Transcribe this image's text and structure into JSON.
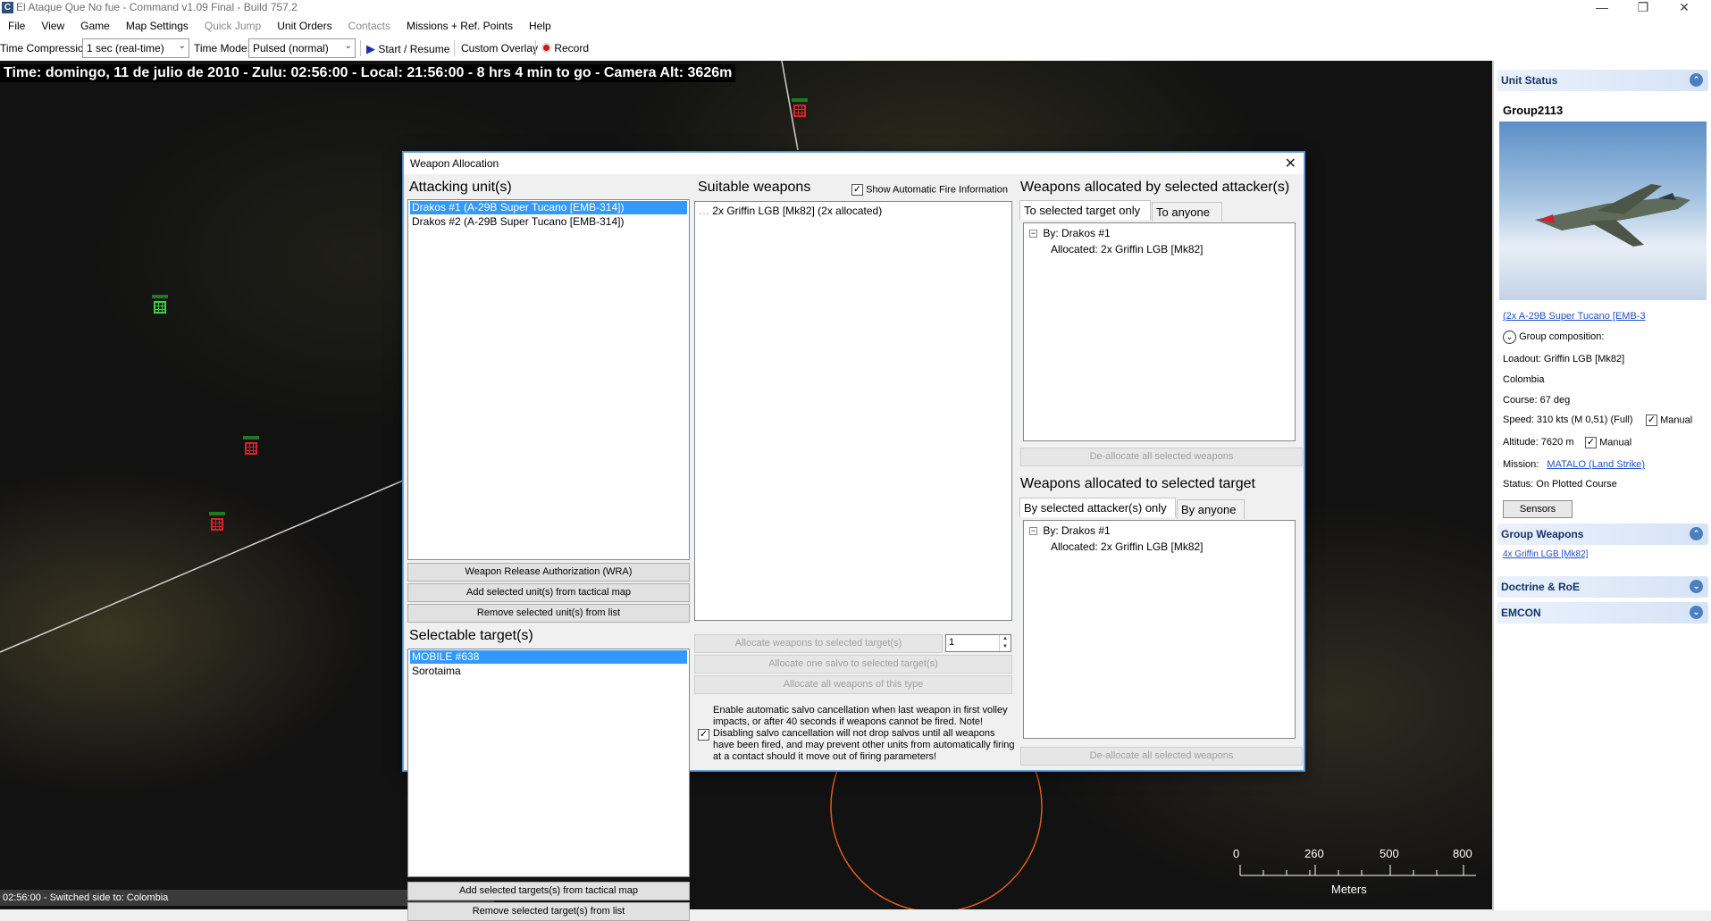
{
  "window": {
    "title": "El Ataque Que No fue - Command v1.09 Final - Build 757.2",
    "icon": "app-logo-icon"
  },
  "menu": {
    "items": [
      {
        "label": "File",
        "enabled": true
      },
      {
        "label": "View",
        "enabled": true
      },
      {
        "label": "Game",
        "enabled": true
      },
      {
        "label": "Map Settings",
        "enabled": true
      },
      {
        "label": "Quick Jump",
        "enabled": false
      },
      {
        "label": "Unit Orders",
        "enabled": true
      },
      {
        "label": "Contacts",
        "enabled": false
      },
      {
        "label": "Missions + Ref. Points",
        "enabled": true
      },
      {
        "label": "Help",
        "enabled": true
      }
    ]
  },
  "toolbar": {
    "time_compression_label": "Time Compression:",
    "time_compression_value": "1 sec (real-time)",
    "time_mode_label": "Time Mode:",
    "time_mode_value": "Pulsed (normal)",
    "start_label": "Start / Resume",
    "custom_overlay_label": "Custom Overlay",
    "record_label": "Record"
  },
  "map": {
    "time_banner": "Time: domingo, 11 de julio de 2010 - Zulu: 02:56:00 - Local: 21:56:00 - 8 hrs 4 min to go -  Camera Alt: 3626m",
    "scale": {
      "ticks": [
        "0",
        "260",
        "500",
        "800"
      ],
      "units": "Meters"
    },
    "status_line": "02:56:00 - Switched side to: Colombia"
  },
  "dialog": {
    "title": "Weapon Allocation",
    "attacking_units": {
      "heading": "Attacking unit(s)",
      "items": [
        {
          "label": "Drakos #1 (A-29B Super Tucano [EMB-314])",
          "selected": true
        },
        {
          "label": "Drakos #2 (A-29B Super Tucano [EMB-314])",
          "selected": false
        }
      ],
      "buttons": {
        "wra": "Weapon Release Authorization (WRA)",
        "add_units": "Add selected unit(s) from tactical map",
        "remove_units": "Remove selected unit(s) from list"
      }
    },
    "targets": {
      "heading": "Selectable target(s)",
      "items": [
        {
          "label": "MOBILE #638",
          "selected": true
        },
        {
          "label": "Sorotaima",
          "selected": false
        }
      ],
      "buttons": {
        "add_targets": "Add selected targets(s) from tactical map",
        "remove_targets": "Remove selected target(s) from list"
      }
    },
    "weapons": {
      "heading": "Suitable weapons",
      "show_auto_fire_label": "Show Automatic Fire Information",
      "show_auto_fire_checked": true,
      "items": [
        "2x Griffin LGB [Mk82] (2x allocated)"
      ],
      "quantity_value": "1",
      "buttons": {
        "allocate_to_targets": "Allocate weapons to selected target(s)",
        "allocate_salvo": "Allocate one salvo to selected target(s)",
        "allocate_all": "Allocate all weapons of this type"
      },
      "salvo_cancel_checked": true,
      "salvo_cancel_text": "Enable automatic salvo cancellation when last weapon in first volley impacts, or after 40 seconds if weapons cannot be fired. Note! Disabling salvo cancellation will not drop salvos until all weapons have been fired, and may prevent other units from automatically firing at a contact should it move out of firing parameters!"
    },
    "allocated_by_attacker": {
      "heading": "Weapons allocated by selected attacker(s)",
      "tabs": [
        "To selected target only",
        "To anyone"
      ],
      "tree": {
        "parent": "By: Drakos #1",
        "child": "Allocated: 2x Griffin LGB [Mk82]"
      },
      "deallocate_label": "De-allocate all selected weapons"
    },
    "allocated_to_target": {
      "heading": "Weapons allocated to selected target",
      "tabs": [
        "By selected attacker(s) only",
        "By anyone"
      ],
      "tree": {
        "parent": "By: Drakos #1",
        "child": "Allocated: 2x Griffin LGB [Mk82]"
      },
      "deallocate_label": "De-allocate all selected weapons"
    }
  },
  "unit_status": {
    "header": "Unit Status",
    "group_name": "Group2113",
    "aircraft_link": "(2x A-29B Super Tucano [EMB-3",
    "group_composition_label": "Group composition:",
    "loadout": "Loadout: Griffin LGB [Mk82]",
    "side": "Colombia",
    "course": "Course: 67 deg",
    "speed": "Speed: 310 kts (M 0,51) (Full)",
    "speed_manual_label": "Manual",
    "altitude": "Altitude: 7620 m",
    "altitude_manual_label": "Manual",
    "mission_label": "Mission:",
    "mission_value": "MATALO (Land Strike)",
    "status": "Status: On Plotted Course",
    "sensors_button": "Sensors",
    "group_weapons_header": "Group Weapons",
    "group_weapons_item": "4x Griffin LGB [Mk82]",
    "doctrine_header": "Doctrine & RoE",
    "emcon_header": "EMCON"
  },
  "colors": {
    "selection": "#3399ff",
    "link": "#1f4fcf",
    "hostile_marker": "#e02020",
    "friendly_marker": "#39d339",
    "range_ring": "#e05a20"
  }
}
